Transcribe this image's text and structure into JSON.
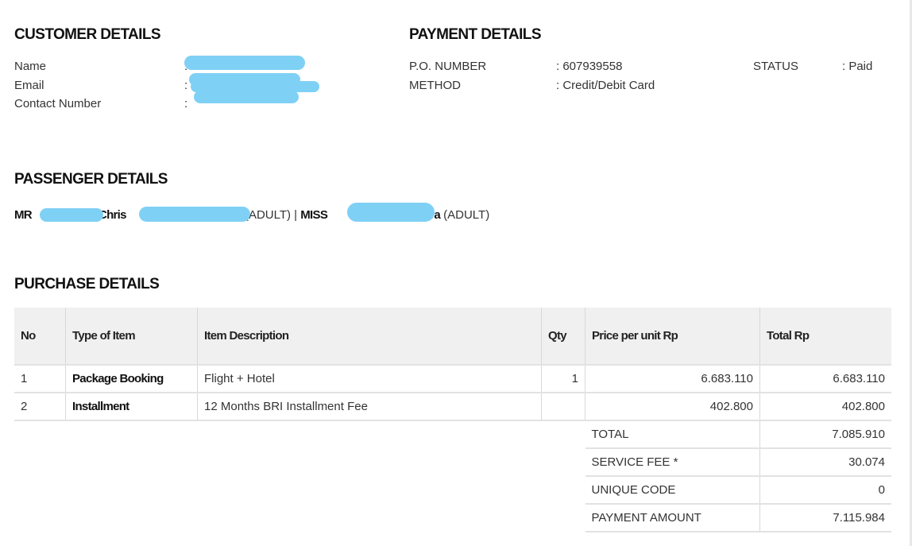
{
  "customer": {
    "title": "CUSTOMER DETAILS",
    "fields": [
      {
        "label": "Name",
        "value": ":"
      },
      {
        "label": "Email",
        "value": ":"
      },
      {
        "label": "Contact Number",
        "value": ":"
      }
    ]
  },
  "payment": {
    "title": "PAYMENT DETAILS",
    "po_label": "P.O. NUMBER",
    "po_value": ": 607939558",
    "method_label": "METHOD",
    "method_value": ": Credit/Debit Card",
    "status_label": "STATUS",
    "status_value": ": Paid"
  },
  "passenger": {
    "title": "PASSENGER DETAILS",
    "p1_prefix": "MR",
    "p1_mid": "Chris",
    "p1_type": "(ADULT) |",
    "p2_prefix": "MISS",
    "p2_end": "Adira",
    "p2_type": "(ADULT)"
  },
  "purchase": {
    "title": "PURCHASE DETAILS",
    "headers": [
      "No",
      "Type of Item",
      "Item Description",
      "Qty",
      "Price per unit Rp",
      "Total Rp"
    ],
    "rows": [
      [
        "1",
        "Package Booking",
        "Flight + Hotel",
        "1",
        "6.683.110",
        "6.683.110"
      ],
      [
        "2",
        "Installment",
        "12 Months BRI Installment Fee",
        "",
        "402.800",
        "402.800"
      ]
    ],
    "summary": [
      [
        "TOTAL",
        "7.085.910"
      ],
      [
        "SERVICE FEE *",
        "30.074"
      ],
      [
        "UNIQUE CODE",
        "0"
      ],
      [
        "PAYMENT AMOUNT",
        "7.115.984"
      ]
    ]
  },
  "colors": {
    "redaction": "#7fd0f5",
    "header_bg": "#f0f0f0"
  }
}
